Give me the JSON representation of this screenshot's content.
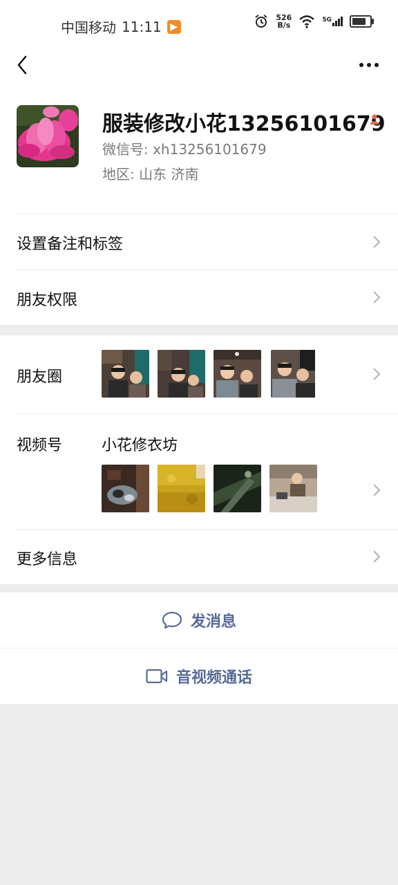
{
  "status_bar": {
    "carrier": "中国移动",
    "time": "11:11",
    "net_speed_value": "526",
    "net_speed_unit": "B/s",
    "network": "5G",
    "app_icon_glyph": "▶"
  },
  "profile": {
    "name": "服装修改小花13256101679",
    "wechat_id": "微信号: xh13256101679",
    "region": "地区: 山东  济南"
  },
  "menu": {
    "remark_tags": "设置备注和标签",
    "friend_permissions": "朋友权限",
    "moments": "朋友圈",
    "channels": "视频号",
    "channel_name": "小花修衣坊",
    "more_info": "更多信息"
  },
  "actions": {
    "send_message": "发消息",
    "video_call": "音视频通话"
  },
  "colors": {
    "link_blue": "#576b95",
    "background_gray": "#ededed",
    "white": "#ffffff"
  },
  "icons": {
    "back": "chevron-left-icon",
    "more": "more-dots-icon",
    "alarm": "alarm-icon",
    "wifi": "wifi-icon",
    "signal": "signal-icon",
    "battery": "battery-icon",
    "chat": "chat-bubble-icon",
    "video": "video-camera-icon",
    "gender": "person-icon"
  },
  "battery_level": 0.8
}
